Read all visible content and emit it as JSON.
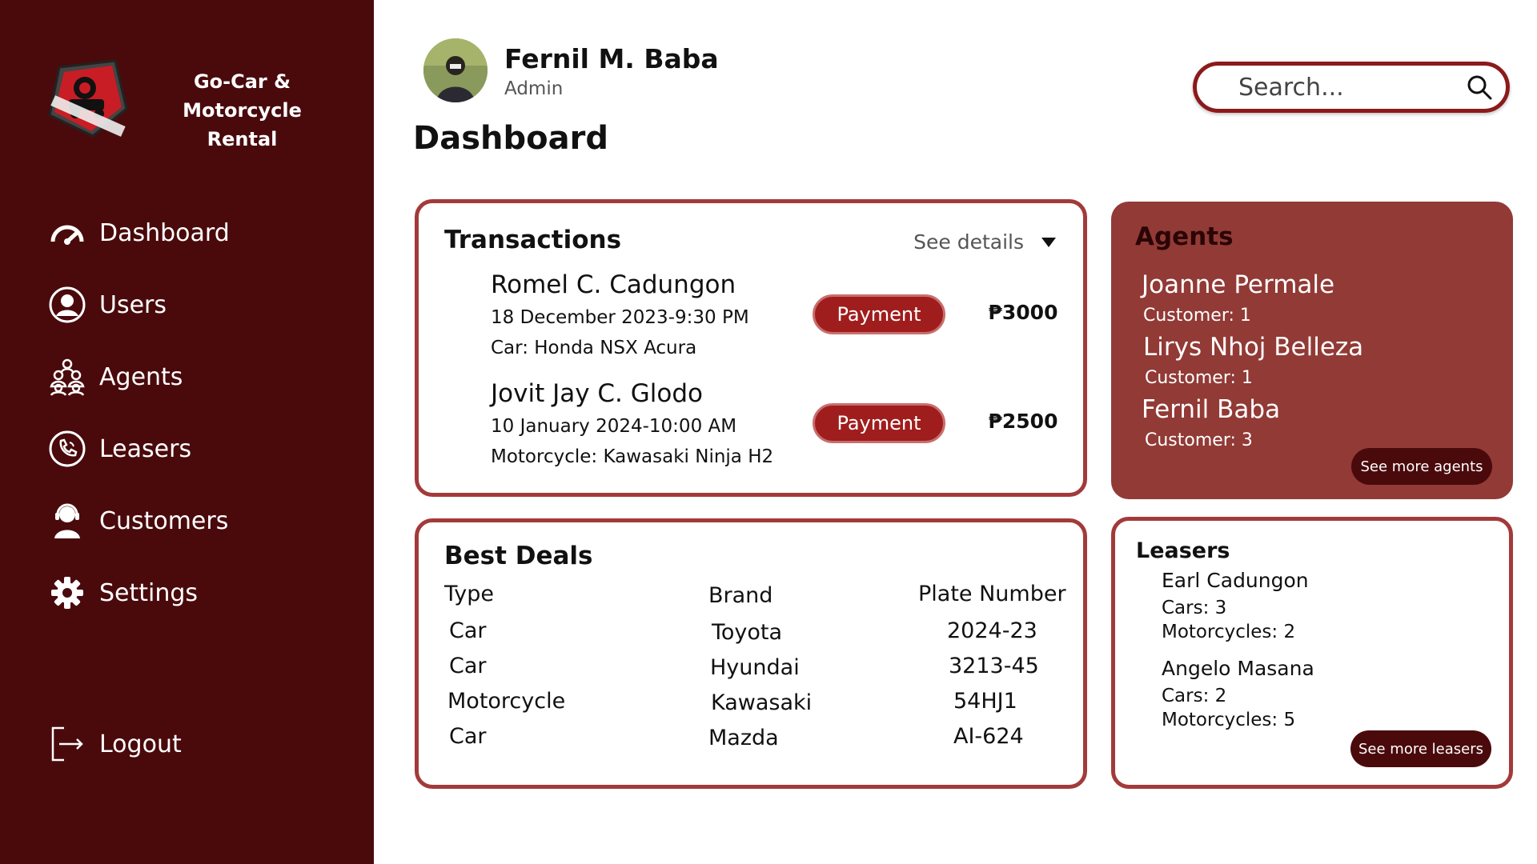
{
  "brand": {
    "line1": "Go-Car & Motorcycle",
    "line2": "Rental"
  },
  "nav": [
    {
      "label": "Dashboard",
      "icon": "gauge-icon"
    },
    {
      "label": "Users",
      "icon": "user-circle-icon"
    },
    {
      "label": "Agents",
      "icon": "group-icon"
    },
    {
      "label": "Leasers",
      "icon": "phone-icon"
    },
    {
      "label": "Customers",
      "icon": "support-icon"
    },
    {
      "label": "Settings",
      "icon": "gear-icon"
    }
  ],
  "logout": {
    "label": "Logout"
  },
  "user": {
    "name": "Fernil M. Baba",
    "role": "Admin"
  },
  "page_title": "Dashboard",
  "search": {
    "placeholder": "Search..."
  },
  "transactions": {
    "title": "Transactions",
    "see_details": "See details",
    "items": [
      {
        "name": "Romel C. Cadungon",
        "date": "18 December 2023-9:30 PM",
        "vehicle": "Car: Honda NSX Acura",
        "status": "Payment",
        "amount": "₱3000"
      },
      {
        "name": "Jovit Jay C. Glodo",
        "date": "10 January 2024-10:00 AM",
        "vehicle": "Motorcycle: Kawasaki Ninja H2",
        "status": "Payment",
        "amount": "₱2500"
      }
    ]
  },
  "best_deals": {
    "title": "Best Deals",
    "headers": [
      "Type",
      "Brand",
      "Plate Number"
    ],
    "rows": [
      [
        "Car",
        "Toyota",
        "2024-23"
      ],
      [
        "Car",
        "Hyundai",
        "3213-45"
      ],
      [
        "Motorcycle",
        "Kawasaki",
        "54HJ1"
      ],
      [
        "Car",
        "Mazda",
        "AI-624"
      ]
    ]
  },
  "agents": {
    "title": "Agents",
    "items": [
      {
        "name": "Joanne Permale",
        "customers": "Customer: 1"
      },
      {
        "name": "Lirys Nhoj Belleza",
        "customers": "Customer: 1"
      },
      {
        "name": "Fernil Baba",
        "customers": "Customer: 3"
      }
    ],
    "more": "See more agents"
  },
  "leasers": {
    "title": "Leasers",
    "items": [
      {
        "name": "Earl Cadungon",
        "cars": "Cars: 3",
        "motorcycles": "Motorcycles: 2"
      },
      {
        "name": "Angelo Masana",
        "cars": "Cars: 2",
        "motorcycles": "Motorcycles: 5"
      }
    ],
    "more": "See more leasers"
  },
  "colors": {
    "sidebar": "#4a0a0c",
    "accent": "#a01d1d",
    "agents_bg": "#923a36",
    "border": "#a33a3a"
  }
}
